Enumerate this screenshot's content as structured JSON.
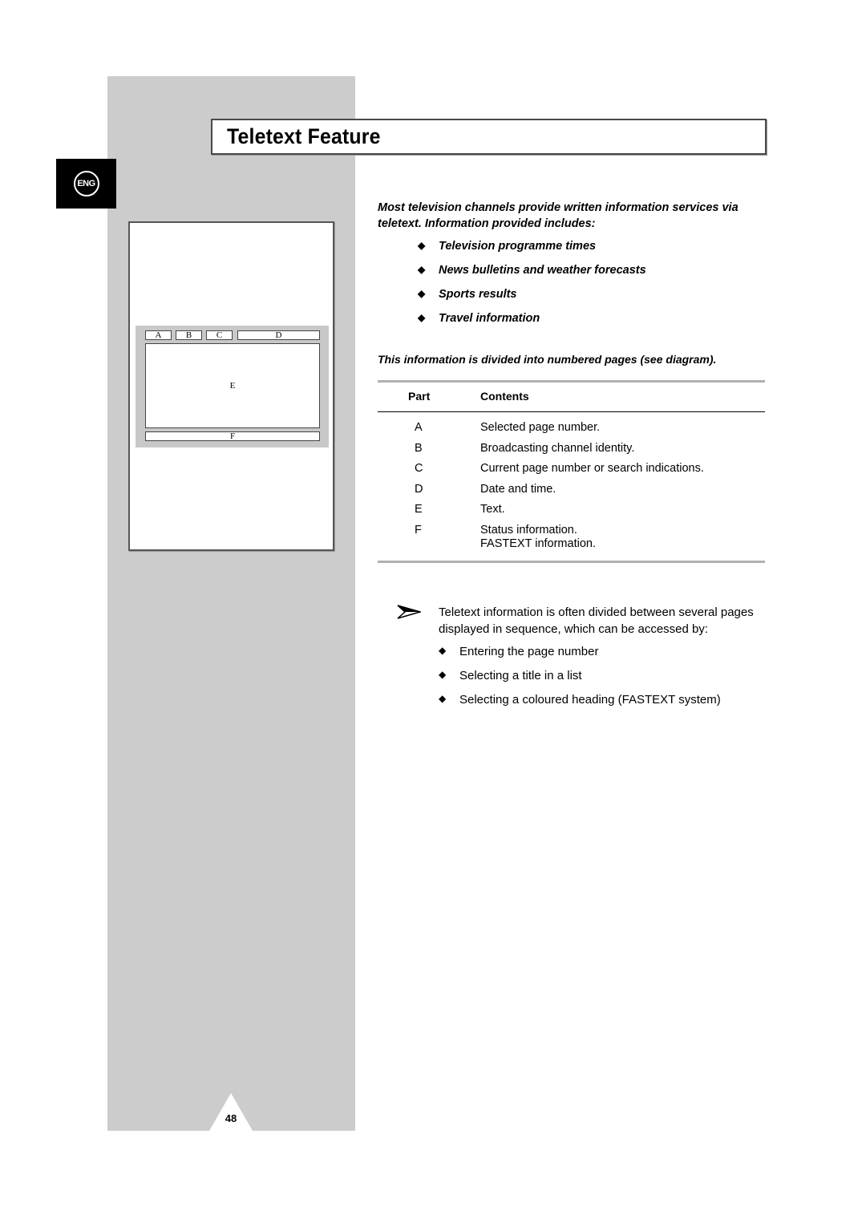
{
  "page": {
    "title": "Teletext Feature",
    "language_badge": "ENG",
    "page_number": "48"
  },
  "diagram": {
    "labels": {
      "a": "A",
      "b": "B",
      "c": "C",
      "d": "D",
      "e": "E",
      "f": "F"
    }
  },
  "intro": {
    "text": "Most television channels provide written information services via teletext. Information provided includes:",
    "bullet_icon": "diamond-bullet",
    "bullets": [
      "Television programme times",
      "News bulletins and weather forecasts",
      "Sports results",
      "Travel information"
    ],
    "divided_text": "This information is divided into numbered pages (see diagram)."
  },
  "table": {
    "headers": {
      "part": "Part",
      "contents": "Contents"
    },
    "rows": [
      {
        "part": "A",
        "contents": [
          "Selected page number."
        ]
      },
      {
        "part": "B",
        "contents": [
          "Broadcasting channel identity."
        ]
      },
      {
        "part": "C",
        "contents": [
          "Current page number or search indications."
        ]
      },
      {
        "part": "D",
        "contents": [
          "Date and time."
        ]
      },
      {
        "part": "E",
        "contents": [
          "Text."
        ]
      },
      {
        "part": "F",
        "contents": [
          "Status information.",
          "FASTEXT information."
        ]
      }
    ]
  },
  "note": {
    "icon": "arrow-right-icon",
    "text": "Teletext information is often divided between several pages displayed in sequence, which can be accessed by:",
    "bullets": [
      "Entering the page number",
      "Selecting a title in a list",
      "Selecting a coloured heading (FASTEXT system)"
    ]
  }
}
